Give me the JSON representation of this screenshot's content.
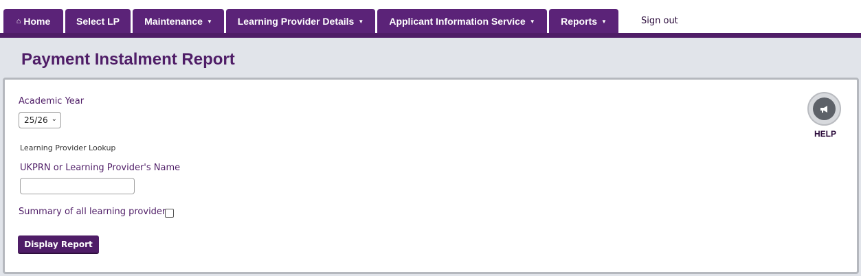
{
  "nav": {
    "tabs": [
      {
        "label": "Home",
        "dropdown": false
      },
      {
        "label": "Select LP",
        "dropdown": false
      },
      {
        "label": "Maintenance",
        "dropdown": true
      },
      {
        "label": "Learning Provider Details",
        "dropdown": true
      },
      {
        "label": "Applicant Information Service",
        "dropdown": true
      },
      {
        "label": "Reports",
        "dropdown": true
      }
    ],
    "signout": "Sign out"
  },
  "page": {
    "title": "Payment Instalment Report"
  },
  "form": {
    "academic_year_label": "Academic Year",
    "academic_year_value": "25/26",
    "lookup_heading": "Learning Provider Lookup",
    "ukprn_label": "UKPRN or Learning Provider's Name",
    "ukprn_value": "",
    "summary_label": "Summary of all learning providers",
    "summary_checked": false,
    "display_button": "Display Report"
  },
  "help": {
    "label": "HELP",
    "icon": "megaphone-icon"
  },
  "colors": {
    "brand_purple": "#5b2378",
    "nav_line": "#4f1d67",
    "content_bg": "#e1e4ea"
  }
}
